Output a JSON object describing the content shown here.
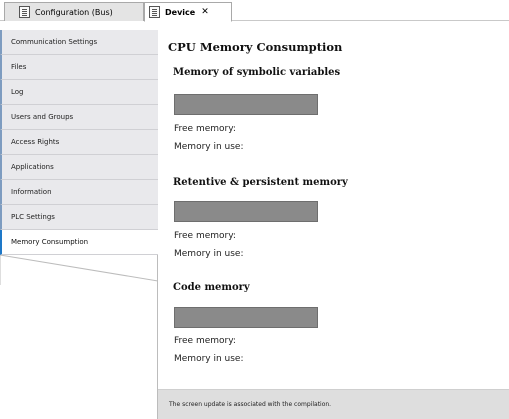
{
  "tabs": {
    "config": {
      "label": "Configuration (Bus)",
      "icon": "config-icon"
    },
    "device": {
      "label": "Device",
      "close": "✕",
      "icon": "device-icon"
    }
  },
  "nav": {
    "items": [
      {
        "label": "Communication Settings"
      },
      {
        "label": "Files"
      },
      {
        "label": "Log"
      },
      {
        "label": "Users and Groups"
      },
      {
        "label": "Access Rights"
      },
      {
        "label": "Applications"
      },
      {
        "label": "Information"
      },
      {
        "label": "PLC Settings"
      },
      {
        "label": "Memory Consumption",
        "active": true
      }
    ]
  },
  "main": {
    "title": "CPU Memory Consumption",
    "sections": [
      {
        "title": "Memory of symbolic variables",
        "free_label": "Free memory:",
        "inuse_label": "Memory in use:"
      },
      {
        "title": "Retentive & persistent memory",
        "free_label": "Free memory:",
        "inuse_label": "Memory in use:"
      },
      {
        "title": "Code memory",
        "free_label": "Free memory:",
        "inuse_label": "Memory in use:"
      }
    ]
  },
  "status": {
    "text": "The screen update is associated with the compilation."
  },
  "colors": {
    "bar": "#8a8a8a",
    "active_accent": "#1e78c8",
    "nav_bg": "#e9e9ec"
  }
}
